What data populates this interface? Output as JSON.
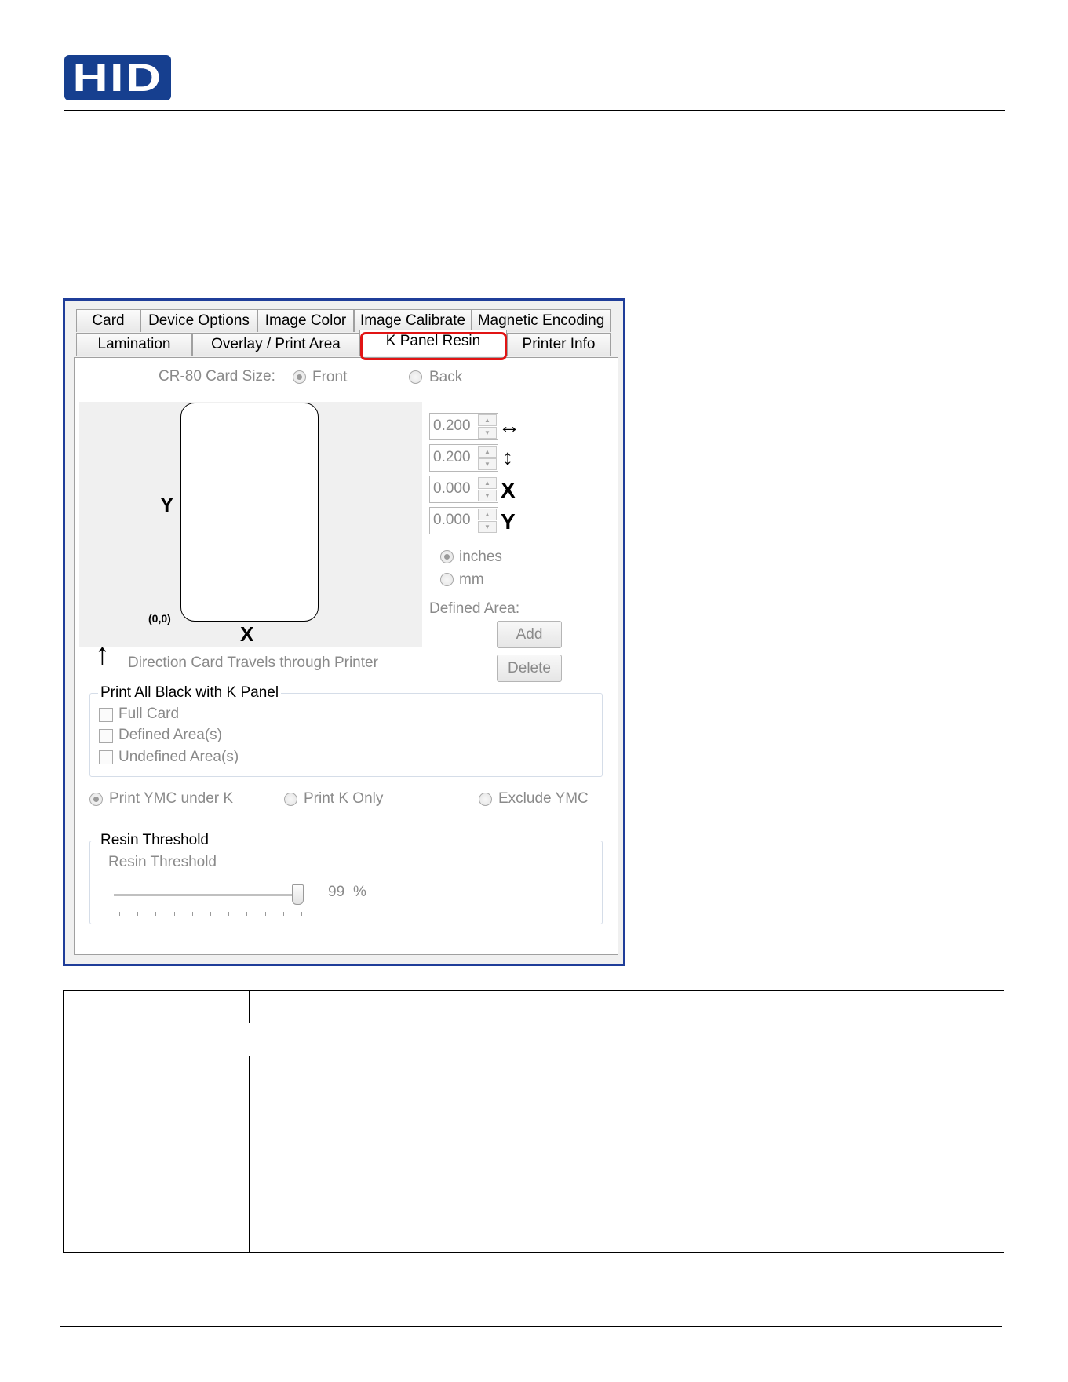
{
  "logo": {
    "text": "HID"
  },
  "tabs_row1": [
    "Card",
    "Device Options",
    "Image Color",
    "Image Calibrate",
    "Magnetic Encoding"
  ],
  "tabs_row2": [
    "Lamination",
    "Overlay / Print Area",
    "K Panel Resin",
    "Printer Info"
  ],
  "card_size": {
    "label": "CR-80 Card Size:",
    "front": "Front",
    "back": "Back",
    "selected": "Front"
  },
  "preview": {
    "y_label": "Y",
    "x_label": "X",
    "origin": "(0,0)",
    "direction": "Direction Card Travels through Printer"
  },
  "fields": [
    {
      "value": "0.200",
      "icon": "width-arrows-icon",
      "glyph": "↔"
    },
    {
      "value": "0.200",
      "icon": "height-arrows-icon",
      "glyph": "↕"
    },
    {
      "value": "0.000",
      "icon": "x-offset-icon",
      "glyph": "X"
    },
    {
      "value": "0.000",
      "icon": "y-offset-icon",
      "glyph": "Y"
    }
  ],
  "units": {
    "inches": "inches",
    "mm": "mm",
    "selected": "inches"
  },
  "defined_area": {
    "label": "Defined Area:",
    "add": "Add",
    "delete": "Delete"
  },
  "print_black": {
    "title": "Print All Black with K Panel",
    "full_card": "Full Card",
    "defined": "Defined Area(s)",
    "undefined": "Undefined Area(s)"
  },
  "ymc_options": {
    "under_k": "Print YMC under K",
    "k_only": "Print K Only",
    "exclude": "Exclude YMC",
    "selected": "Print YMC under K"
  },
  "resin": {
    "group_title": "Resin Threshold",
    "label": "Resin Threshold",
    "value": "99",
    "unit": "%",
    "level": 0.99
  },
  "table": {
    "rows": 6
  }
}
